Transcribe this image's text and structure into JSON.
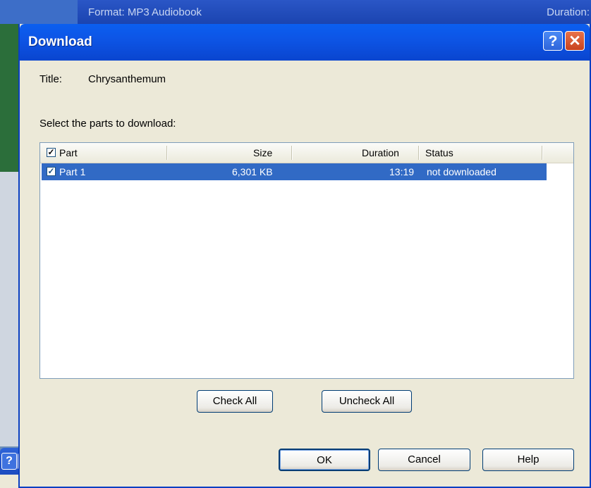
{
  "background": {
    "format_text": "Format: MP3 Audiobook",
    "duration_text": "Duration:",
    "small_window_help": "?",
    "small_window_close": "✕"
  },
  "dialog": {
    "title": "Download",
    "help_glyph": "?",
    "close_glyph": "✕",
    "title_label": "Title:",
    "title_value": "Chrysanthemum",
    "select_label": "Select the parts to download:",
    "columns": [
      "Part",
      "Size",
      "Duration",
      "Status"
    ],
    "rows": [
      {
        "part": "Part 1",
        "size": "6,301 KB",
        "duration": "13:19",
        "status": "not downloaded",
        "checked": true,
        "selected": true
      }
    ],
    "check_all": "Check All",
    "uncheck_all": "Uncheck All",
    "ok": "OK",
    "cancel": "Cancel",
    "help": "Help"
  },
  "colors": {
    "titlebar": "#0a45cf",
    "selection": "#316ac5",
    "dialog_bg": "#ece9d8"
  }
}
